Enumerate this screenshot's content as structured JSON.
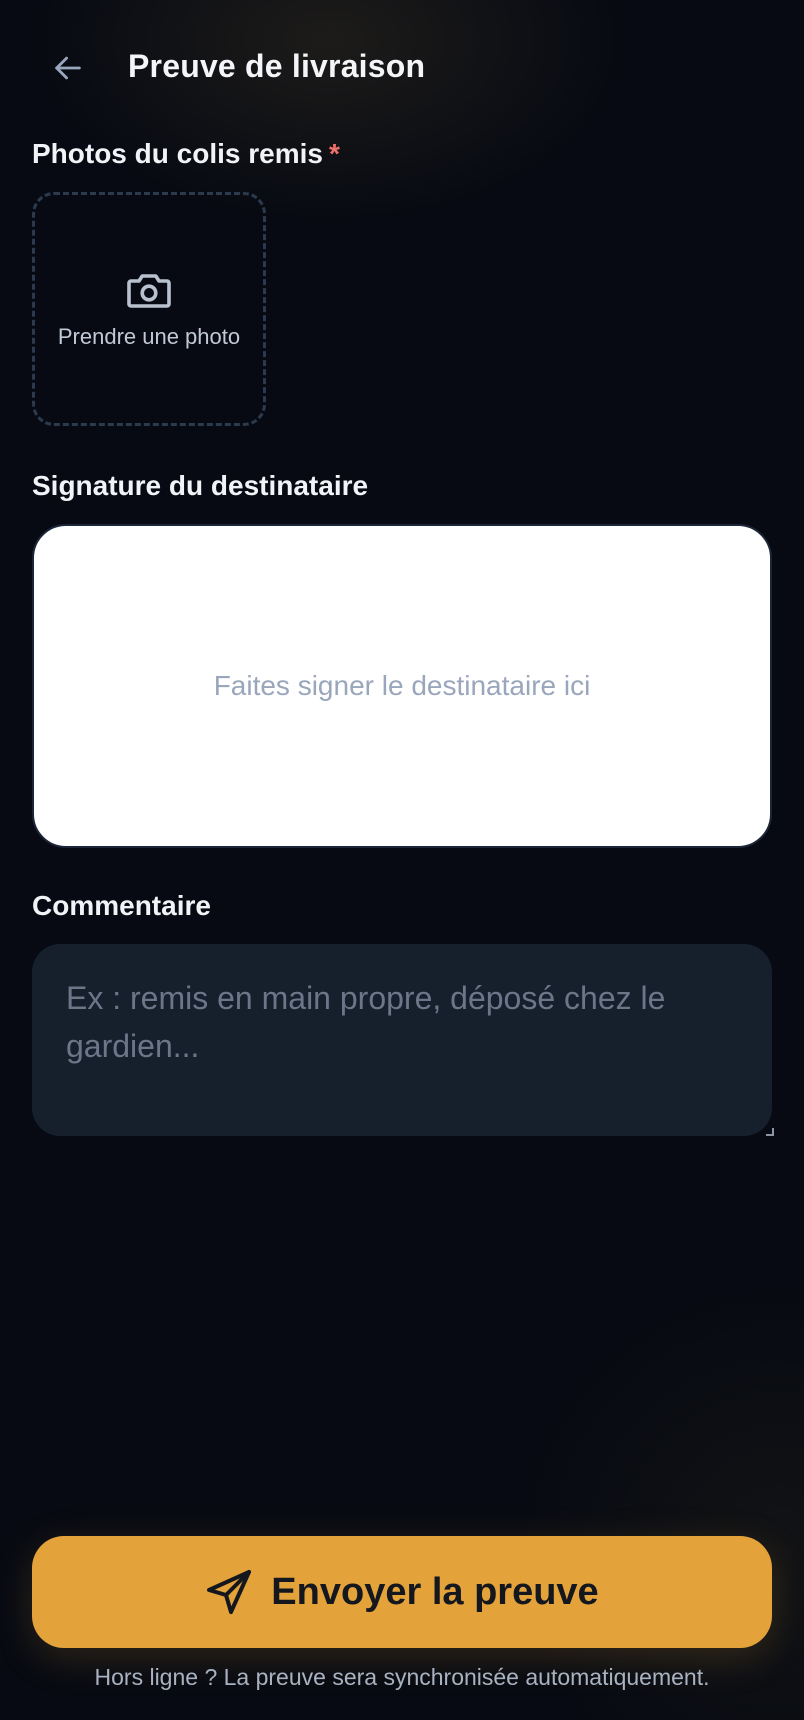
{
  "header": {
    "title": "Preuve de livraison",
    "back_icon": "arrow-left-icon"
  },
  "photos": {
    "label": "Photos du colis remis",
    "required_marker": "*",
    "add_label": "Prendre une photo",
    "icon": "camera-icon"
  },
  "signature": {
    "label": "Signature du destinataire",
    "placeholder": "Faites signer le destinataire ici"
  },
  "comment": {
    "label": "Commentaire",
    "placeholder": "Ex : remis en main propre, déposé chez le gardien...",
    "value": ""
  },
  "submit": {
    "label": "Envoyer la preuve",
    "icon": "send-icon"
  },
  "footer": {
    "note": "Hors ligne ? La preuve sera synchronisée automatiquement."
  },
  "colors": {
    "background": "#070a12",
    "accent": "#e3a23a",
    "required": "#f0706a",
    "input_bg": "#161f2c",
    "signature_bg": "#ffffff"
  }
}
